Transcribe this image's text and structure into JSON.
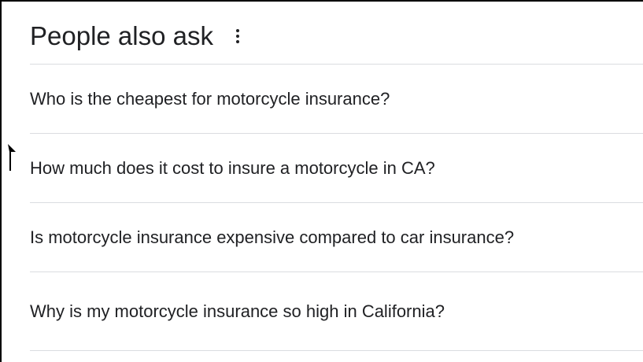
{
  "panel": {
    "title": "People also ask",
    "more_icon": "more-vert-icon"
  },
  "questions": [
    {
      "text": "Who is the cheapest for motorcycle insurance?"
    },
    {
      "text": "How much does it cost to insure a motorcycle in CA?"
    },
    {
      "text": "Is motorcycle insurance expensive compared to car insurance?"
    },
    {
      "text": "Why is my motorcycle insurance so high in California?"
    }
  ],
  "colors": {
    "text": "#202124",
    "divider": "#dadce0",
    "frame": "#000000"
  }
}
